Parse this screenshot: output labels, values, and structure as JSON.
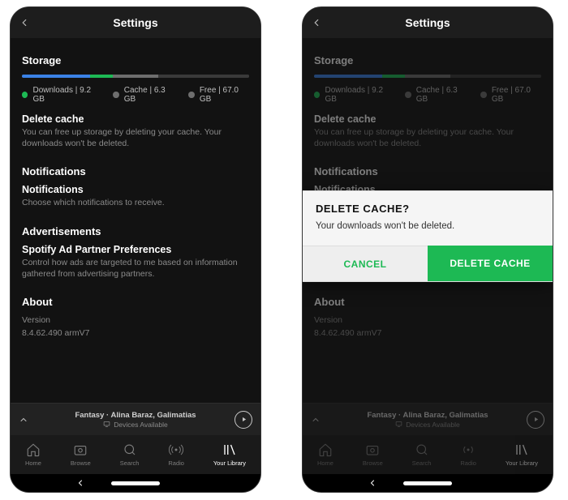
{
  "header": {
    "title": "Settings"
  },
  "storage": {
    "section": "Storage",
    "legend": {
      "downloads": "Downloads | 9.2 GB",
      "cache": "Cache | 6.3 GB",
      "free": "Free | 67.0 GB"
    },
    "delete_cache_title": "Delete cache",
    "delete_cache_desc": "You can free up storage by deleting your cache. Your downloads won't be deleted."
  },
  "notifications": {
    "section": "Notifications",
    "item_title": "Notifications",
    "item_desc": "Choose which notifications to receive."
  },
  "ads": {
    "section": "Advertisements",
    "item_title": "Spotify Ad Partner Preferences",
    "item_desc": "Control how ads are targeted to me based on information gathered from advertising partners."
  },
  "about": {
    "section": "About",
    "version_label": "Version",
    "version_value": "8.4.62.490 armV7"
  },
  "now_playing": {
    "track": "Fantasy",
    "artist": "Alina Baraz, Galimatias",
    "devices": "Devices Available"
  },
  "nav": {
    "home": "Home",
    "browse": "Browse",
    "search": "Search",
    "radio": "Radio",
    "library": "Your Library"
  },
  "dialog": {
    "title": "DELETE CACHE?",
    "message": "Your downloads won't be deleted.",
    "cancel": "CANCEL",
    "confirm": "DELETE CACHE"
  },
  "colors": {
    "accent": "#1db954",
    "blue": "#3b82e6"
  }
}
